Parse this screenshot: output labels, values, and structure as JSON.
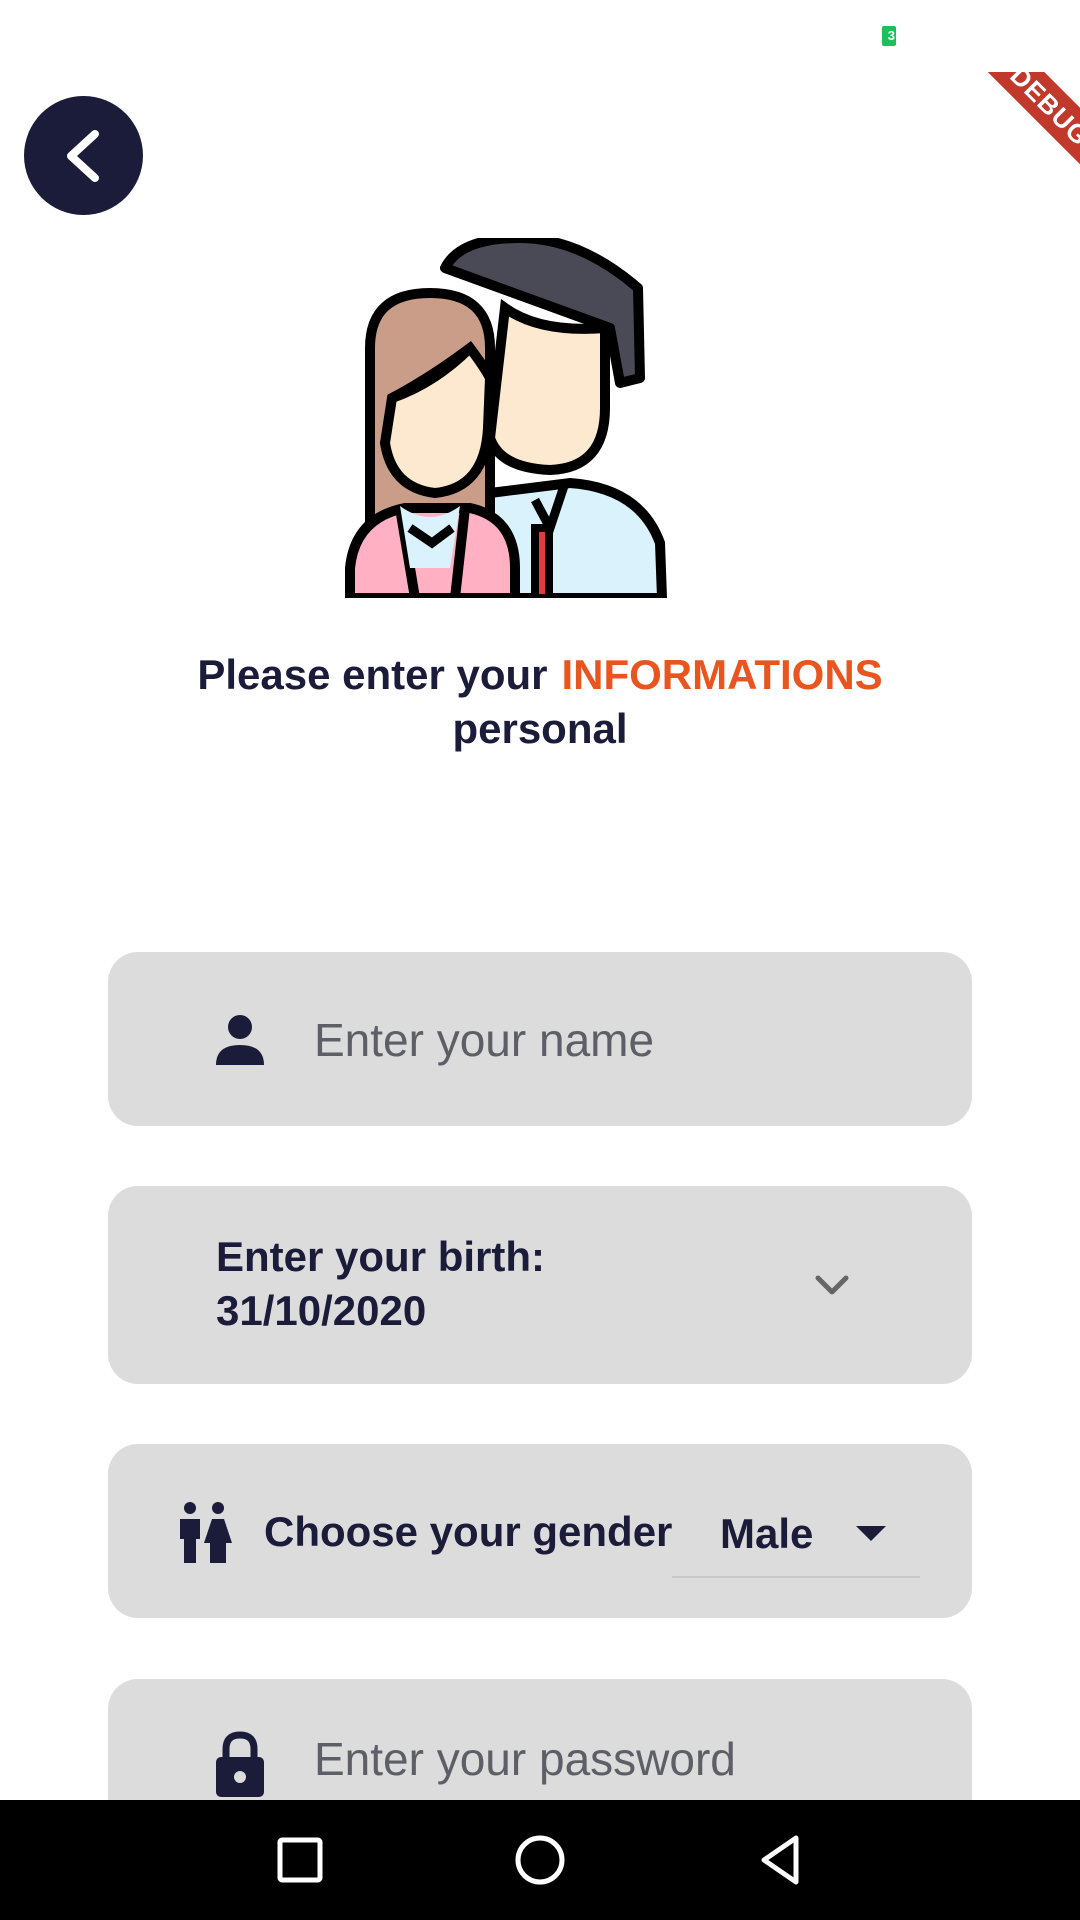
{
  "status_bar": {
    "battery_label": "3"
  },
  "debug_ribbon": {
    "label": "DEBUG"
  },
  "header": {
    "back_icon": "chevron-left-icon"
  },
  "heading": {
    "line1": "Please enter your",
    "accent": "INFORMATIONS",
    "line2": "personal",
    "accent_color": "#e8551f"
  },
  "form": {
    "name": {
      "placeholder": "Enter your name",
      "icon": "person-icon"
    },
    "birth": {
      "label": "Enter your birth:",
      "value": "31/10/2020",
      "icon": "chevron-down-icon"
    },
    "gender": {
      "label": "Choose your gender",
      "value": "Male",
      "icon": "gender-icon"
    },
    "password": {
      "placeholder": "Enter your password",
      "icon": "lock-icon"
    }
  },
  "colors": {
    "primary": "#1b1b3a",
    "field_bg": "#dcdcdc",
    "nav_bg": "#000000"
  },
  "nav_bar": {
    "items": [
      "recents",
      "home",
      "back"
    ]
  }
}
